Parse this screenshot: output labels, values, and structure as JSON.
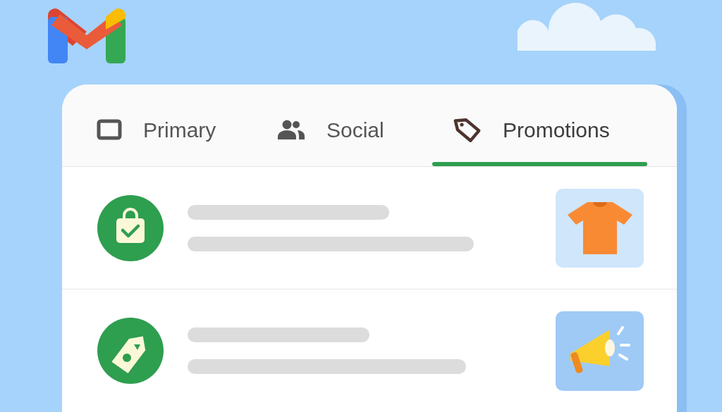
{
  "tabs": [
    {
      "label": "Primary",
      "kind": "inbox",
      "selected": false
    },
    {
      "label": "Social",
      "kind": "people",
      "selected": false
    },
    {
      "label": "Promotions",
      "kind": "tag",
      "selected": true
    }
  ],
  "messages": [
    {
      "kind": "purchase"
    },
    {
      "kind": "deal"
    }
  ]
}
